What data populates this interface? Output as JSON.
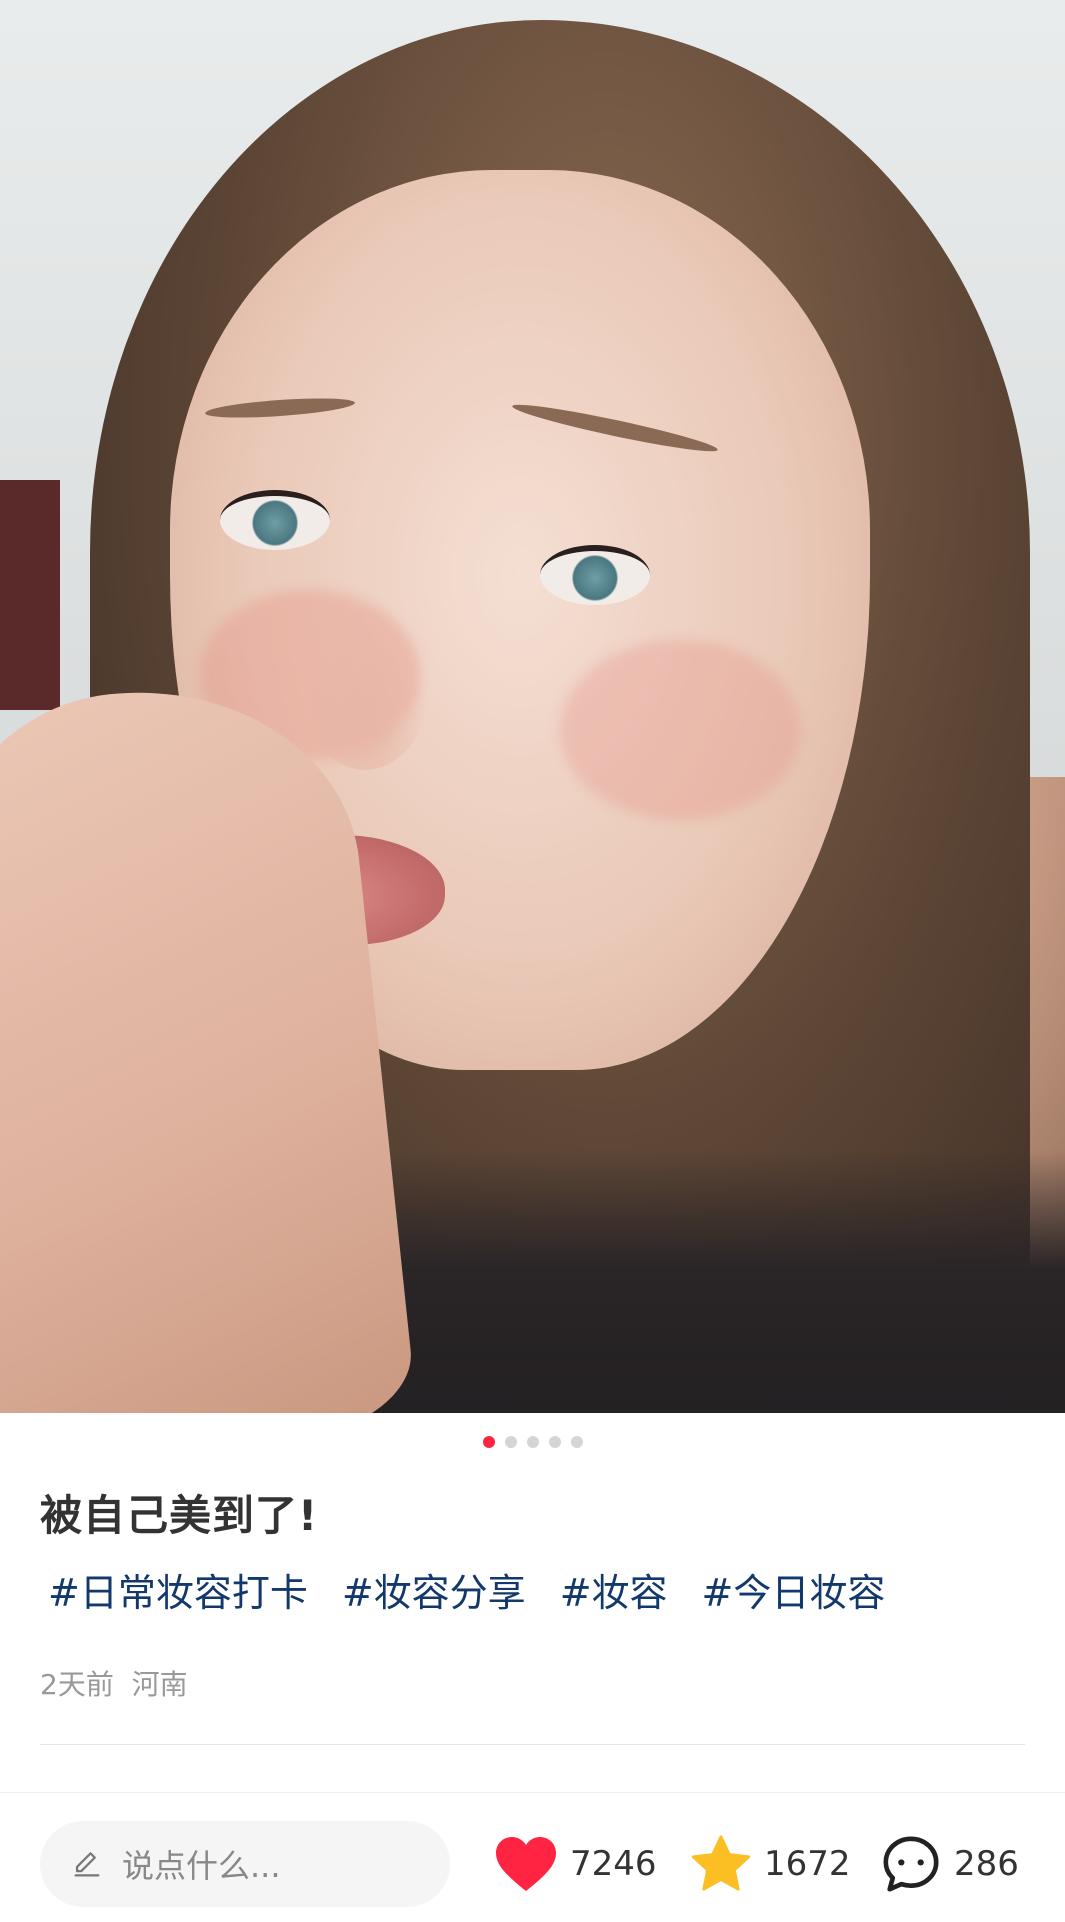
{
  "post": {
    "image_dots": {
      "total": 5,
      "active_index": 0
    },
    "title": "被自己美到了!",
    "tags": [
      "#日常妆容打卡",
      "#妆容分享",
      "#妆容",
      "#今日妆容"
    ],
    "meta": "2天前  河南"
  },
  "bottom_bar": {
    "comment_placeholder": "说点什么...",
    "likes": "7246",
    "favorites": "1672",
    "comments": "286"
  },
  "colors": {
    "accent": "#ff2442",
    "tag": "#13386c",
    "star": "#fbbf24",
    "heart": "#ff2442"
  },
  "icons": {
    "edit": "pencil-icon",
    "like": "heart-icon",
    "favorite": "star-icon",
    "comment": "chat-bubble-icon"
  }
}
